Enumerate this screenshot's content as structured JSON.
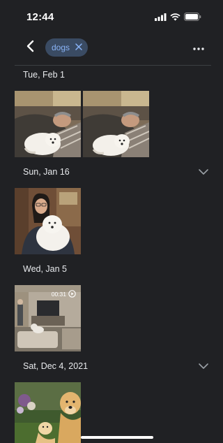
{
  "status_bar": {
    "time": "12:44",
    "icons": [
      "signal-icon",
      "wifi-icon",
      "battery-icon"
    ]
  },
  "app_bar": {
    "back_icon": "chevron-left-icon",
    "filter_chip_label": "dogs",
    "chip_close_icon": "close-icon",
    "more_icon": "more-horizontal-icon"
  },
  "groups": [
    {
      "date": "Tue, Feb 1",
      "items": [
        "photo",
        "photo"
      ]
    },
    {
      "date": "Sun, Jan 16",
      "items": [
        "photo"
      ]
    },
    {
      "date": "Wed, Jan 5",
      "items": [
        "video"
      ],
      "video_duration": "00:31"
    },
    {
      "date": "Sat, Dec 4, 2021",
      "items": [
        "photo"
      ]
    }
  ],
  "colors": {
    "background": "#202124",
    "chip_background": "#3a4b63",
    "chip_text": "#8ab4f8",
    "text": "#e8eaed"
  }
}
